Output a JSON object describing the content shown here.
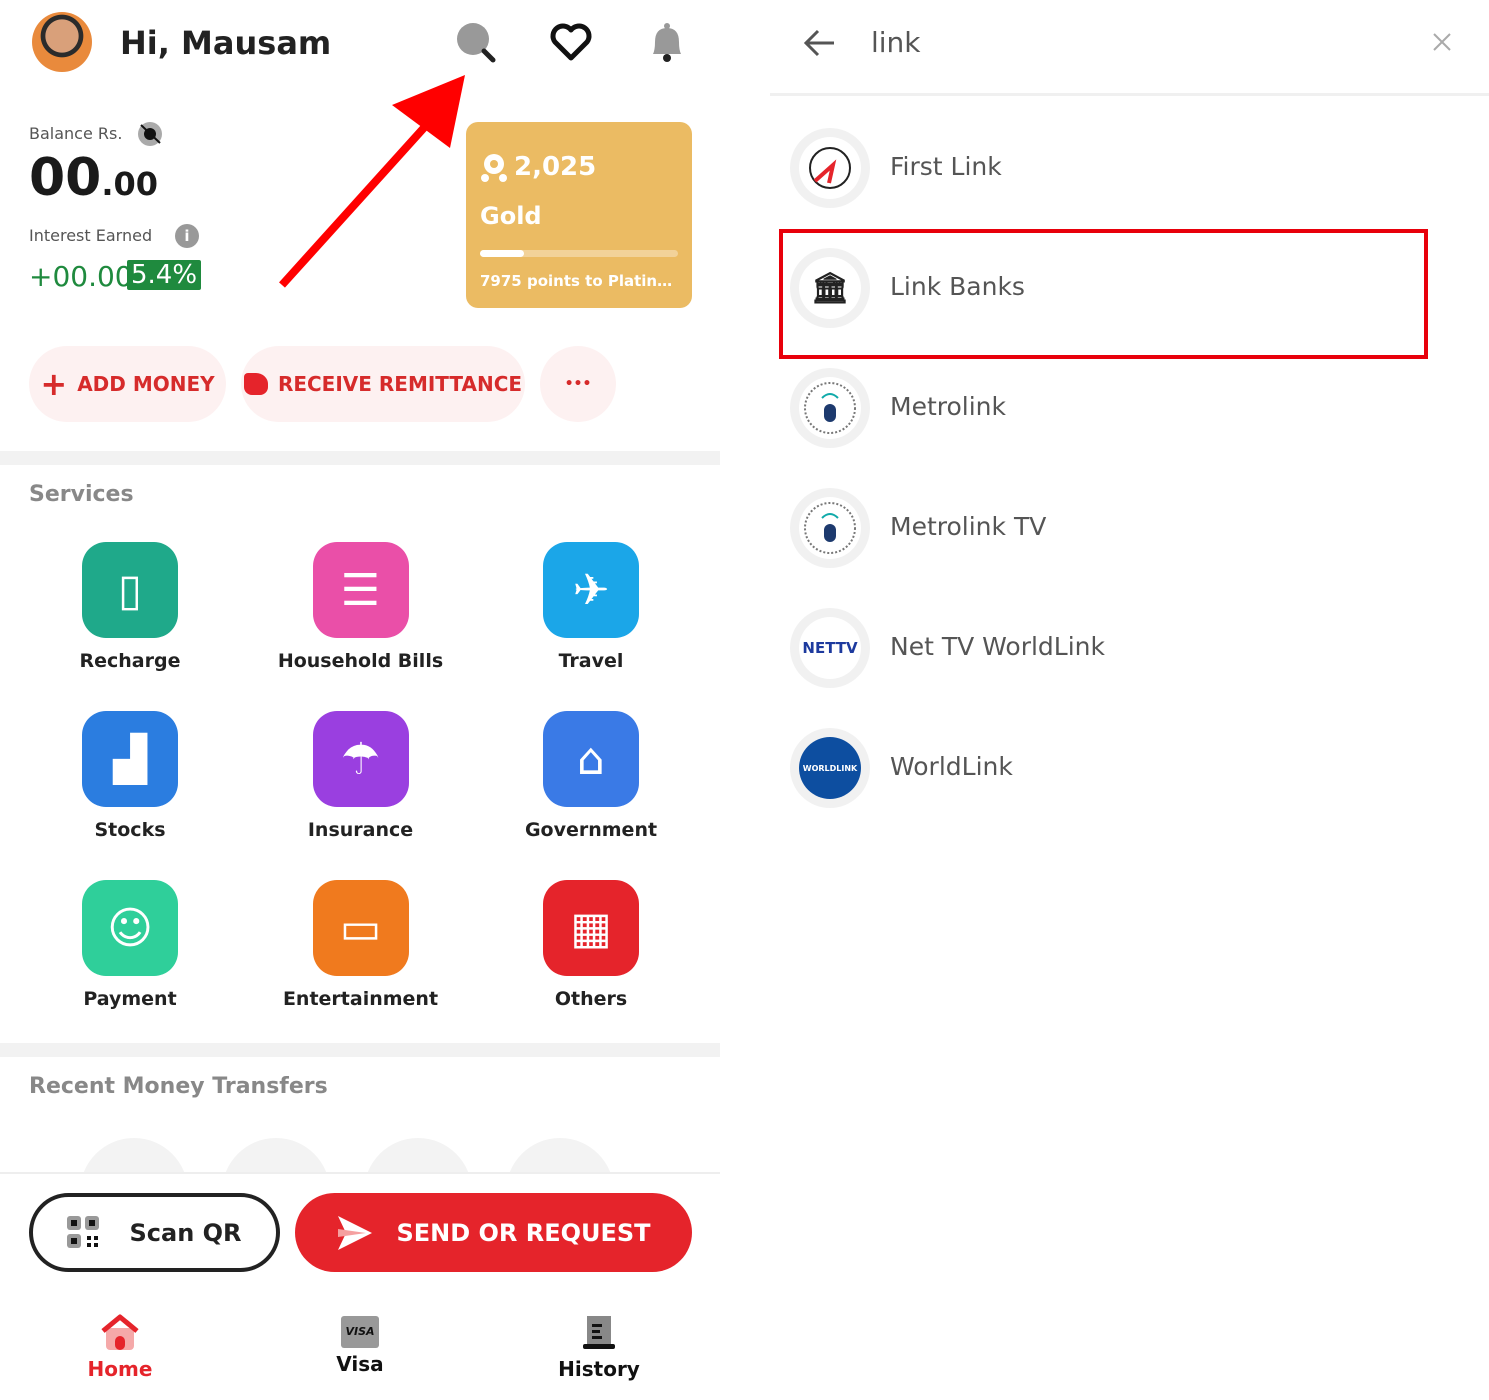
{
  "header": {
    "greeting": "Hi, Mausam"
  },
  "balance": {
    "label": "Balance Rs.",
    "whole": "00",
    "decimal": ".00",
    "interest_label": "Interest Earned",
    "interest_value": "+00.00",
    "rate": "5.4%"
  },
  "rewards": {
    "points": "2,025",
    "tier": "Gold",
    "progress_percent": 22,
    "to_next": "7975 points to Platinu..."
  },
  "actions": {
    "add_money": "ADD MONEY",
    "receive_remittance": "RECEIVE REMITTANCE",
    "more": "•••"
  },
  "services": {
    "title": "Services",
    "items": [
      {
        "label": "Recharge",
        "icon": "recharge-icon",
        "color": "#1fa98a"
      },
      {
        "label": "Household Bills",
        "icon": "bill-icon",
        "color": "#ea4fa8"
      },
      {
        "label": "Travel",
        "icon": "plane-icon",
        "color": "#1ba6e8"
      },
      {
        "label": "Stocks",
        "icon": "stocks-icon",
        "color": "#2b7de0"
      },
      {
        "label": "Insurance",
        "icon": "umbrella-icon",
        "color": "#9a3fe0"
      },
      {
        "label": "Government",
        "icon": "government-icon",
        "color": "#3a7ae6"
      },
      {
        "label": "Payment",
        "icon": "payment-icon",
        "color": "#2fcf9a"
      },
      {
        "label": "Entertainment",
        "icon": "ticket-icon",
        "color": "#f07a1e"
      },
      {
        "label": "Others",
        "icon": "grid-icon",
        "color": "#e5242b"
      }
    ]
  },
  "recent": {
    "title": "Recent Money Transfers"
  },
  "bottom": {
    "scan_qr": "Scan QR",
    "send_request": "SEND OR REQUEST"
  },
  "nav": [
    {
      "label": "Home",
      "active": true
    },
    {
      "label": "Visa"
    },
    {
      "label": "History"
    }
  ],
  "search": {
    "query": "link",
    "results": [
      {
        "name": "First Link",
        "icon": "first-link-logo"
      },
      {
        "name": "Link Banks",
        "icon": "bank-icon",
        "highlighted": true
      },
      {
        "name": "Metrolink",
        "icon": "metrolink-logo"
      },
      {
        "name": "Metrolink TV",
        "icon": "metrolink-logo"
      },
      {
        "name": "Net TV WorldLink",
        "icon": "nettv-logo",
        "logo_text": "NETTV"
      },
      {
        "name": "WorldLink",
        "icon": "worldlink-logo",
        "logo_text": "WORLDLINK"
      }
    ]
  },
  "colors": {
    "brand_red": "#e5242b",
    "gold": "#ebbb63",
    "green": "#1f8a3e",
    "highlight": "#e8000b"
  }
}
